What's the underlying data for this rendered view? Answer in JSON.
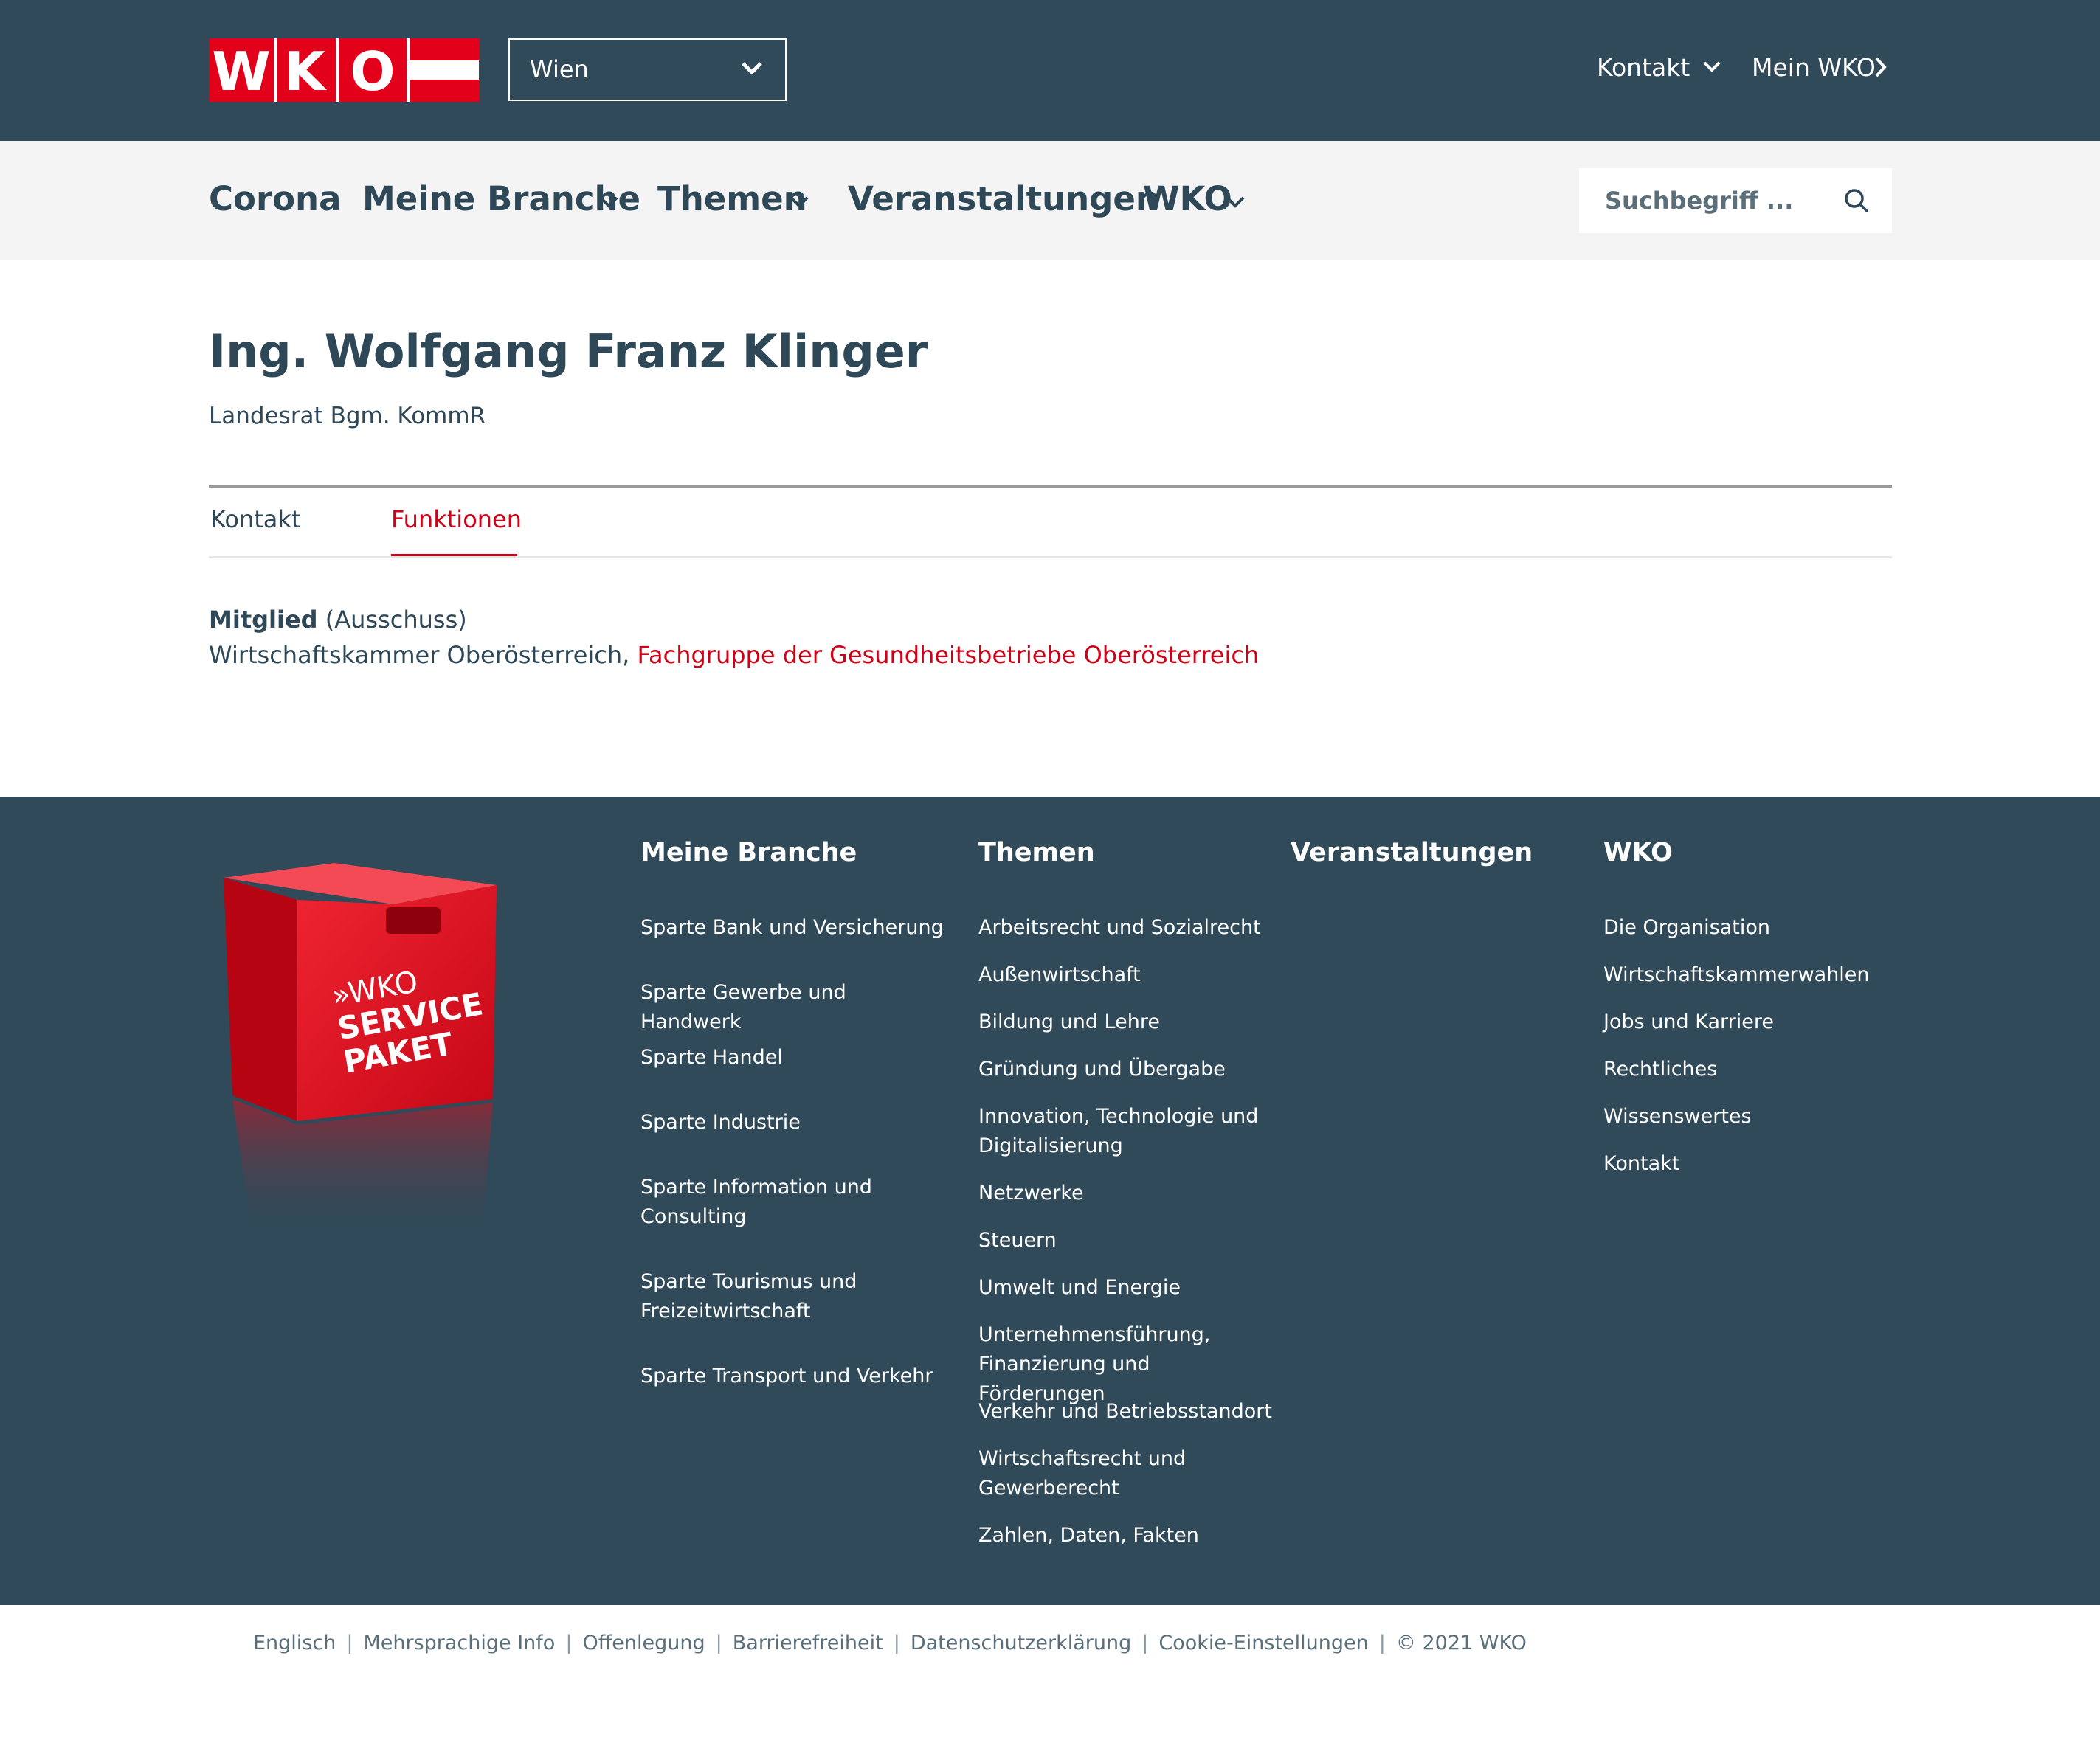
{
  "header": {
    "logo_text": "WKO",
    "region": "Wien",
    "contact_label": "Kontakt",
    "mein_wko_label": "Mein WKO"
  },
  "nav": {
    "items": [
      {
        "label": "Corona"
      },
      {
        "label": "Meine Branche"
      },
      {
        "label": "Themen"
      },
      {
        "label": "Veranstaltungen"
      },
      {
        "label": "WKO"
      }
    ],
    "search_placeholder": "Suchbegriff ..."
  },
  "person": {
    "name": "Ing. Wolfgang Franz Klinger",
    "title": "Landesrat Bgm. KommR"
  },
  "tabs": [
    {
      "label": "Kontakt",
      "active": false
    },
    {
      "label": "Funktionen",
      "active": true
    }
  ],
  "function": {
    "role": "Mitglied",
    "body": "(Ausschuss)",
    "org": "Wirtschaftskammer Oberösterreich,",
    "group": "Fachgruppe der Gesundheitsbetriebe Oberösterreich"
  },
  "footer": {
    "service_box_text": [
      "»WKO",
      "SERVICE",
      "PAKET"
    ],
    "columns": [
      {
        "title": "Meine Branche",
        "links": [
          "Sparte Bank und Versicherung",
          "Sparte Gewerbe und Handwerk",
          "Sparte Handel",
          "Sparte Industrie",
          "Sparte Information und Consulting",
          "Sparte Tourismus und Freizeitwirtschaft",
          "Sparte Transport und Verkehr"
        ]
      },
      {
        "title": "Themen",
        "links": [
          "Arbeitsrecht und Sozialrecht",
          "Außenwirtschaft",
          "Bildung und Lehre",
          "Gründung und Übergabe",
          "Innovation, Technologie und Digitalisierung",
          "Netzwerke",
          "Steuern",
          "Umwelt und Energie",
          "Unternehmensführung, Finanzierung und Förderungen",
          "Verkehr und Betriebsstandort",
          "Wirtschaftsrecht und Gewerberecht",
          "Zahlen, Daten, Fakten"
        ]
      },
      {
        "title": "Veranstaltungen",
        "links": []
      },
      {
        "title": "WKO",
        "links": [
          "Die Organisation",
          "Wirtschaftskammerwahlen",
          "Jobs und Karriere",
          "Rechtliches",
          "Wissenswertes",
          "Kontakt"
        ]
      }
    ]
  },
  "legal": {
    "links": [
      "Englisch",
      "Mehrsprachige Info",
      "Offenlegung",
      "Barrierefreiheit",
      "Datenschutzerklärung",
      "Cookie-Einstellungen"
    ],
    "copyright": "© 2021 WKO"
  },
  "colors": {
    "brand_dark": "#304a59",
    "brand_red": "#d00016",
    "nav_bg": "#f4f4f4"
  }
}
